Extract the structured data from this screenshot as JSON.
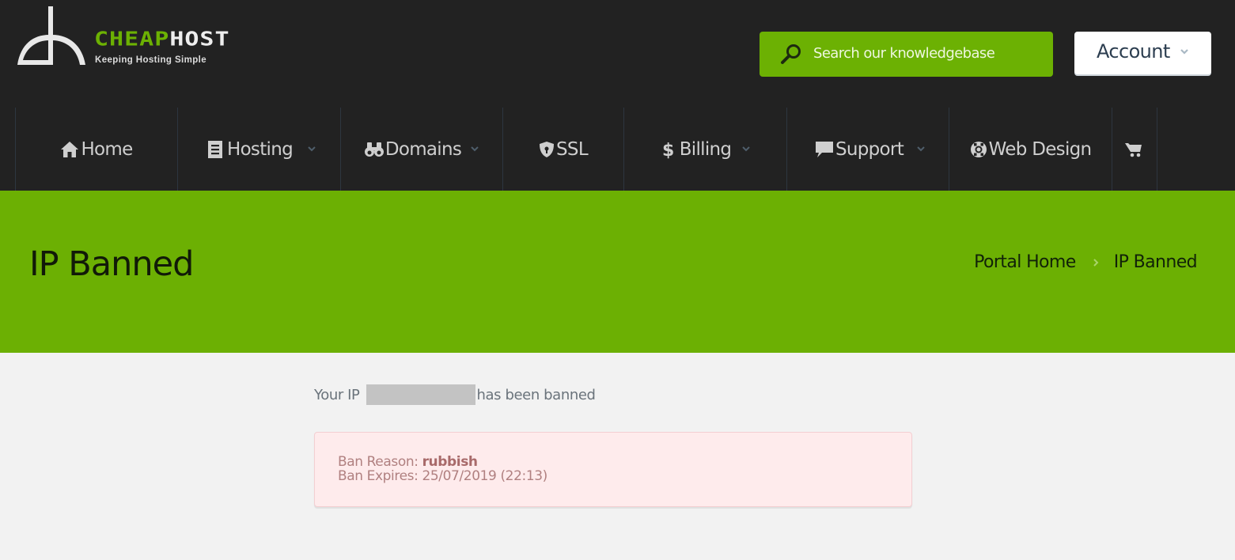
{
  "brand": {
    "name_part1": "CHEAP",
    "name_part2": "HOST",
    "tagline": "Keeping Hosting Simple",
    "accent_color": "#6cb103"
  },
  "header": {
    "search_label": "Search our knowledgebase",
    "account_label": "Account"
  },
  "nav": {
    "items": [
      {
        "label": "Home",
        "icon": "home-icon",
        "dropdown": false
      },
      {
        "label": "Hosting",
        "icon": "document-icon",
        "dropdown": true
      },
      {
        "label": "Domains",
        "icon": "binoculars-icon",
        "dropdown": true
      },
      {
        "label": "SSL",
        "icon": "shield-icon",
        "dropdown": false
      },
      {
        "label": "Billing",
        "icon": "dollar-icon",
        "dropdown": true
      },
      {
        "label": "Support",
        "icon": "comment-icon",
        "dropdown": true
      },
      {
        "label": "Web Design",
        "icon": "lifebuoy-icon",
        "dropdown": false
      },
      {
        "label": "",
        "icon": "cart-icon",
        "dropdown": false
      }
    ]
  },
  "banner": {
    "title": "IP Banned",
    "breadcrumb": [
      {
        "label": "Portal Home"
      },
      {
        "label": "IP Banned"
      }
    ]
  },
  "content": {
    "ip_prefix": "Your IP",
    "ip_suffix": "has been banned",
    "ban_reason_label": "Ban Reason:",
    "ban_reason_value": "rubbish",
    "ban_expires_label": "Ban Expires:",
    "ban_expires_value": "25/07/2019 (22:13)"
  }
}
